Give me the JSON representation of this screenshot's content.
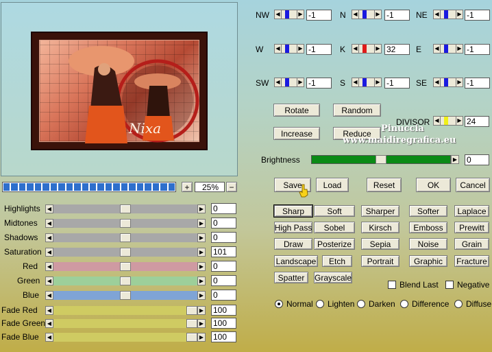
{
  "preview": {
    "image_caption": "Nixa"
  },
  "zoom": {
    "plus": "+",
    "value": "25%",
    "minus": "−"
  },
  "adjust": [
    {
      "label": "Highlights",
      "value": "0",
      "level": 0.5
    },
    {
      "label": "Midtones",
      "value": "0",
      "level": 0.5
    },
    {
      "label": "Shadows",
      "value": "0",
      "level": 0.5
    },
    {
      "label": "Saturation",
      "value": "101",
      "level": 0.5
    },
    {
      "label": "Red",
      "value": "0",
      "level": 0.5
    },
    {
      "label": "Green",
      "value": "0",
      "level": 0.5
    },
    {
      "label": "Blue",
      "value": "0",
      "level": 0.5
    },
    {
      "label": "Fade Red",
      "value": "100",
      "level": 1.0
    },
    {
      "label": "Fade Green",
      "value": "100",
      "level": 1.0
    },
    {
      "label": "Fade Blue",
      "value": "100",
      "level": 1.0
    }
  ],
  "track_colors": {
    "gray": "#a8a8a8",
    "red": "#cf9aa2",
    "green": "#9dcf9a",
    "blue": "#7fa4d6",
    "fade": "#cfcb62"
  },
  "weights": [
    {
      "label": "NW",
      "value": "-1"
    },
    {
      "label": "N",
      "value": "-1"
    },
    {
      "label": "NE",
      "value": "-1"
    },
    {
      "label": "W",
      "value": "-1"
    },
    {
      "label": "K",
      "value": "32"
    },
    {
      "label": "E",
      "value": "-1"
    },
    {
      "label": "SW",
      "value": "-1"
    },
    {
      "label": "S",
      "value": "-1"
    },
    {
      "label": "SE",
      "value": "-1"
    }
  ],
  "weight_marker_color": "#1a1ae0",
  "center_marker_color": "#e01a1a",
  "divisor": {
    "label": "DIVISOR",
    "value": "24",
    "marker_color": "#f0f01a"
  },
  "buttons_top": {
    "rotate": "Rotate",
    "random": "Random",
    "increase": "Increase",
    "reduce": "Reduce"
  },
  "brightness": {
    "label": "Brightness",
    "value": "0",
    "level": 0.5
  },
  "actions": {
    "save": "Save",
    "load": "Load",
    "reset": "Reset",
    "ok": "OK",
    "cancel": "Cancel"
  },
  "presets": [
    [
      "Sharp",
      "Soft",
      "Sharper",
      "Softer",
      "Laplace"
    ],
    [
      "High Pass",
      "Sobel",
      "Kirsch",
      "Emboss",
      "Prewitt"
    ],
    [
      "Draw",
      "Posterize",
      "Sepia",
      "Noise",
      "Grain"
    ],
    [
      "Landscape",
      "Etch",
      "Portrait",
      "Graphic",
      "Fracture"
    ],
    [
      "Spatter",
      "Grayscale"
    ]
  ],
  "checks": {
    "blend_last": "Blend Last",
    "negative": "Negative"
  },
  "modes": [
    "Normal",
    "Lighten",
    "Darken",
    "Difference",
    "Diffuse"
  ],
  "watermark": {
    "line1": "Pinuccia",
    "line2": "www.maidiregrafica.eu"
  }
}
